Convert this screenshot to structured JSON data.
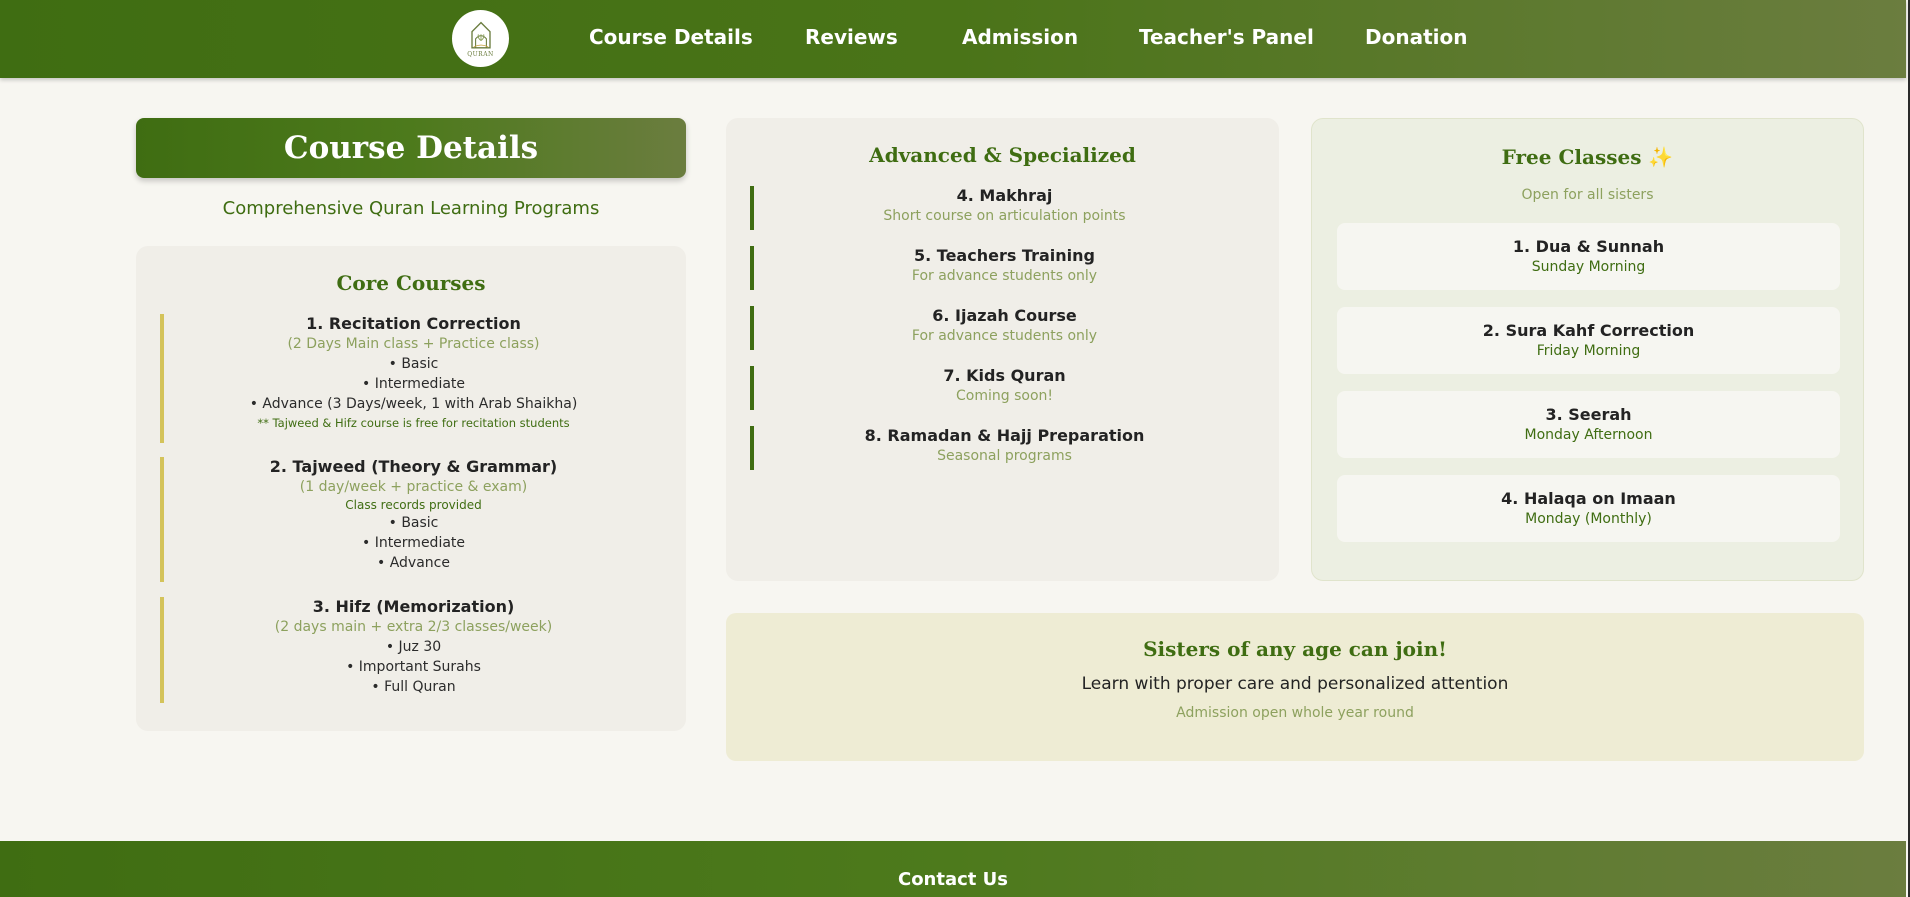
{
  "nav": {
    "logo_text": "QURAN",
    "links": [
      "Course Details",
      "Reviews",
      "Admission",
      "Teacher's Panel",
      "Donation"
    ]
  },
  "page": {
    "title": "Course Details",
    "subtitle": "Comprehensive Quran Learning Programs"
  },
  "core": {
    "title": "Core Courses",
    "courses": [
      {
        "title": "1. Recitation Correction",
        "sub": "(2 Days Main class + Practice class)",
        "items": [
          "• Basic",
          "• Intermediate",
          "• Advance (3 Days/week, 1 with Arab Shaikha)"
        ],
        "note": "** Tajweed & Hifz course is free for recitation students"
      },
      {
        "title": "2. Tajweed (Theory & Grammar)",
        "sub": "(1 day/week + practice & exam)",
        "note": "Class records provided",
        "items": [
          "• Basic",
          "• Intermediate",
          "• Advance"
        ]
      },
      {
        "title": "3. Hifz (Memorization)",
        "sub": "(2 days main + extra 2/3 classes/week)",
        "items": [
          "• Juz 30",
          "• Important Surahs",
          "• Full Quran"
        ]
      }
    ]
  },
  "advanced": {
    "title": "Advanced & Specialized",
    "items": [
      {
        "title": "4. Makhraj",
        "sub": "Short course on articulation points"
      },
      {
        "title": "5. Teachers Training",
        "sub": "For advance students only"
      },
      {
        "title": "6. Ijazah Course",
        "sub": "For advance students only"
      },
      {
        "title": "7. Kids Quran",
        "sub": "Coming soon!"
      },
      {
        "title": "8. Ramadan & Hajj Preparation",
        "sub": "Seasonal programs"
      }
    ]
  },
  "free": {
    "title": "Free Classes ✨",
    "subtitle": "Open for all sisters",
    "items": [
      {
        "title": "1. Dua & Sunnah",
        "sub": "Sunday Morning"
      },
      {
        "title": "2. Sura Kahf Correction",
        "sub": "Friday Morning"
      },
      {
        "title": "3. Seerah",
        "sub": "Monday Afternoon"
      },
      {
        "title": "4. Halaqa on Imaan",
        "sub": "Monday (Monthly)"
      }
    ]
  },
  "sisters": {
    "title": "Sisters of any age can join!",
    "text": "Learn with proper care and personalized attention",
    "note": "Admission open whole year round"
  },
  "footer": {
    "title": "Contact Us"
  }
}
